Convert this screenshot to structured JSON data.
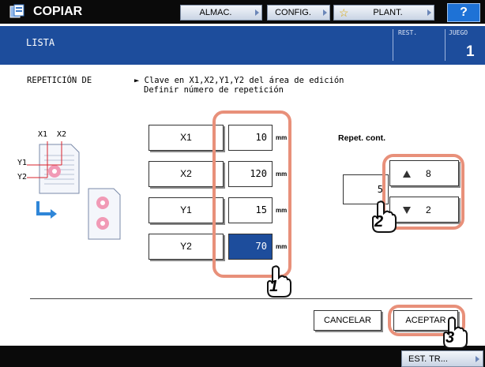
{
  "header": {
    "app_title": "COPIAR",
    "buttons": [
      {
        "label": "ALMAC."
      },
      {
        "label": "CONFIG."
      },
      {
        "label": "PLANT."
      }
    ],
    "help_label": "?"
  },
  "titlebar": {
    "title": "LISTA",
    "rest_label": "REST.",
    "juego_label": "JUEGO",
    "juego_value": "1"
  },
  "main": {
    "repeat_label": "REPETICIÓN DE",
    "instruction_1": "► Clave en X1,X2,Y1,Y2 del área de edición",
    "instruction_2": "Definir número de repetición",
    "diagram": {
      "x1": "X1",
      "x2": "X2",
      "y1": "Y1",
      "y2": "Y2"
    },
    "fields": [
      {
        "label": "X1",
        "value": "10",
        "unit": "mm"
      },
      {
        "label": "X2",
        "value": "120",
        "unit": "mm"
      },
      {
        "label": "Y1",
        "value": "15",
        "unit": "mm"
      },
      {
        "label": "Y2",
        "value": "70",
        "unit": "mm"
      }
    ],
    "repeat": {
      "label": "Repet. cont.",
      "value": "5",
      "up_value": "8",
      "down_value": "2"
    },
    "cancel_label": "CANCELAR",
    "accept_label": "ACEPTAR"
  },
  "footer": {
    "status_label": "EST. TR..."
  },
  "callouts": {
    "one": "1",
    "two": "2",
    "three": "3"
  },
  "colors": {
    "accent_blue": "#1d4d9c",
    "callout": "#e8907a",
    "field_selected": "#1d4d9c"
  }
}
